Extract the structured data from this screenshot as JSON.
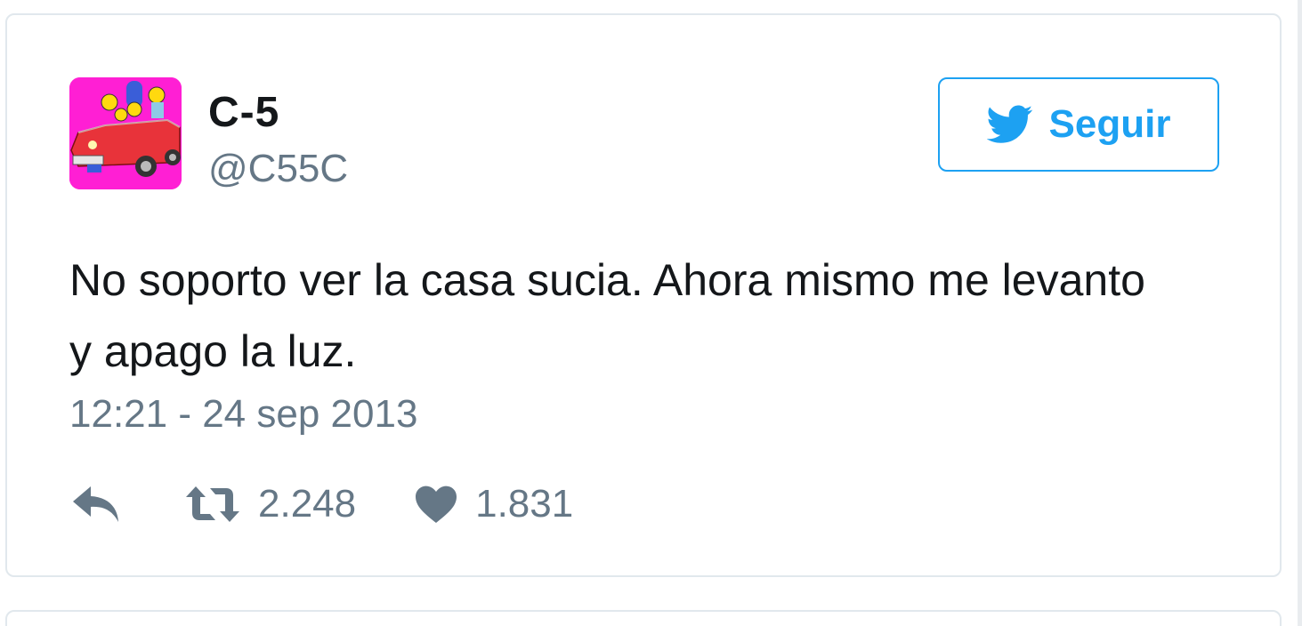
{
  "tweet": {
    "author": {
      "display_name": "C-5",
      "screen_name": "@C55C",
      "avatar_icon": "avatar-cartoon-family-red-car"
    },
    "follow_button": {
      "label": "Seguir",
      "icon": "twitter-bird-icon"
    },
    "text": "No soporto ver la casa sucia. Ahora mismo me levanto y apago la luz.",
    "timestamp": "12:21 - 24 sep 2013",
    "actions": {
      "reply_icon": "reply-icon",
      "retweet_icon": "retweet-icon",
      "retweet_count": "2.248",
      "like_icon": "heart-icon",
      "like_count": "1.831"
    }
  },
  "colors": {
    "accent": "#1da1f2",
    "text_primary": "#14171a",
    "text_secondary": "#657786",
    "border": "#e1e8ed",
    "avatar_background": "#ff1fd4"
  }
}
